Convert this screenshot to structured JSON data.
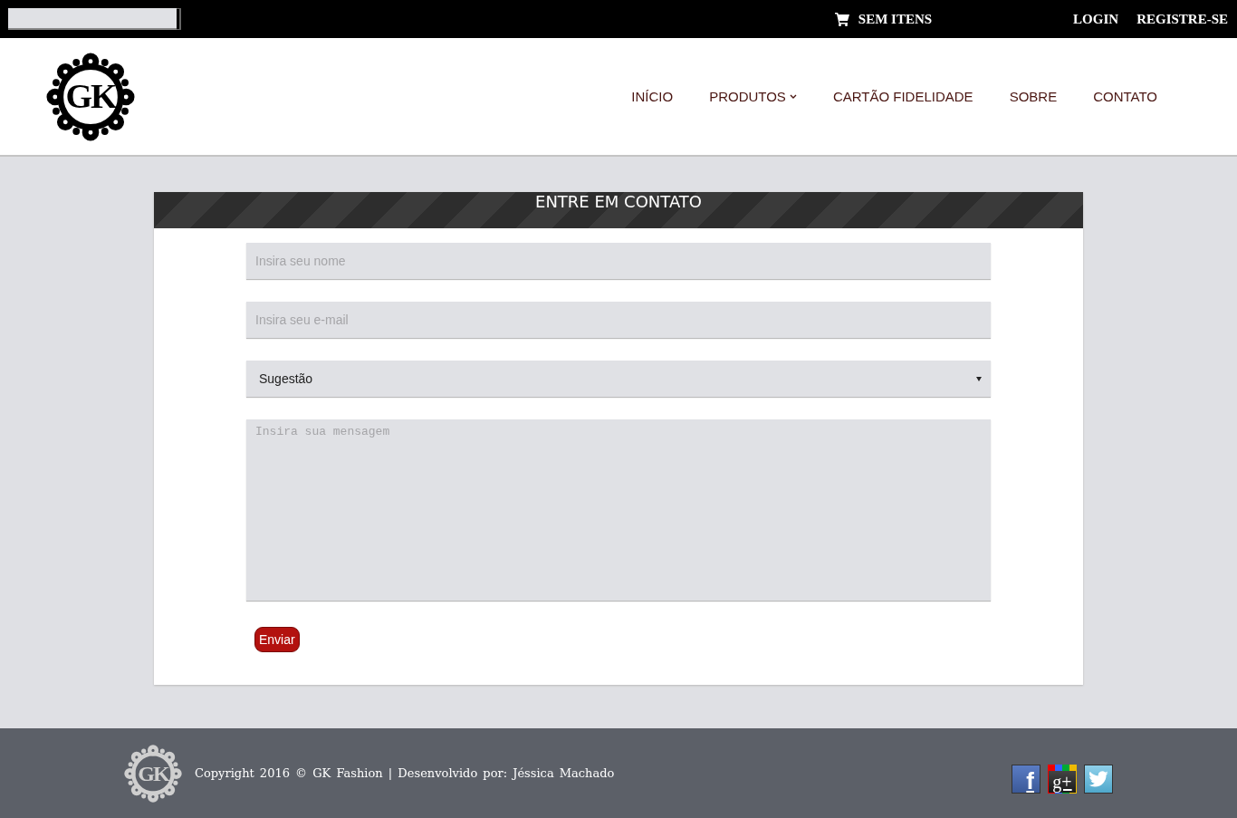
{
  "top_bar": {
    "cart": {
      "label": "SEM ITENS"
    },
    "links": [
      {
        "label": "LOGIN"
      },
      {
        "label": "REGISTRE-SE"
      }
    ]
  },
  "header": {
    "logo": {
      "text": "GK"
    },
    "nav": [
      {
        "label": "INÍCIO",
        "kind": "link"
      },
      {
        "label": "PRODUTOS",
        "kind": "dropdown"
      },
      {
        "label": "CARTÃO FIDELIDADE",
        "kind": "link"
      },
      {
        "label": "SOBRE",
        "kind": "link"
      },
      {
        "label": "CONTATO",
        "kind": "link"
      }
    ]
  },
  "contact_form": {
    "title": "ENTRE EM CONTATO",
    "fields": [
      {
        "kind": "text",
        "placeholder": "Insira seu nome"
      },
      {
        "kind": "text",
        "placeholder": "Insira seu e-mail"
      },
      {
        "kind": "select",
        "value": "Sugestão"
      },
      {
        "kind": "textarea",
        "placeholder": "Insira sua mensagem"
      }
    ],
    "submit": "Enviar"
  },
  "footer": {
    "logo": {
      "text": "GK"
    },
    "text": "Copyright 2016 © GK Fashion | Desenvolvido por: Jéssica Machado",
    "social": [
      {
        "kind": "facebook",
        "glyph": "f"
      },
      {
        "kind": "googleplus",
        "glyph": "g+"
      },
      {
        "kind": "twitter"
      }
    ]
  }
}
